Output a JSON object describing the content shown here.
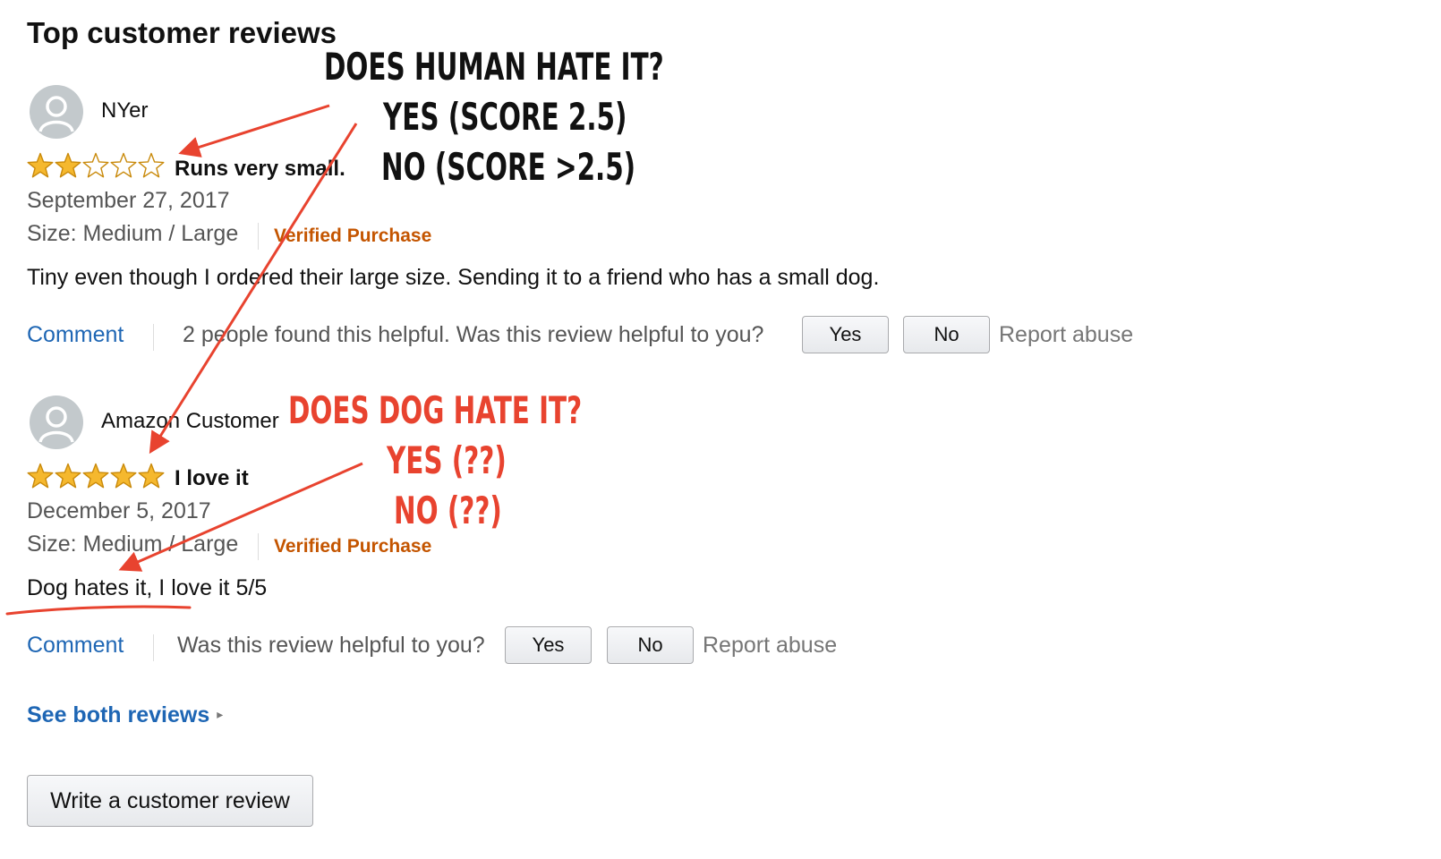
{
  "section_heading": "Top customer reviews",
  "reviews": [
    {
      "reviewer": "NYer",
      "rating": 2,
      "rating_max": 5,
      "title": "Runs very small.",
      "date": "September 27, 2017",
      "size": "Size: Medium / Large",
      "verified": "Verified Purchase",
      "body": "Tiny even though I ordered their large size. Sending it to a friend who has a small dog.",
      "comment_label": "Comment",
      "helpful_text": "2 people found this helpful. Was this review helpful to you?",
      "yes_label": "Yes",
      "no_label": "No",
      "report_label": "Report abuse"
    },
    {
      "reviewer": "Amazon Customer",
      "rating": 5,
      "rating_max": 5,
      "title": "I love it",
      "date": "December 5, 2017",
      "size": "Size: Medium / Large",
      "verified": "Verified Purchase",
      "body": "Dog hates it, I love it 5/5",
      "comment_label": "Comment",
      "helpful_text": "Was this review helpful to you?",
      "yes_label": "Yes",
      "no_label": "No",
      "report_label": "Report abuse"
    }
  ],
  "see_both_label": "See both reviews",
  "write_review_label": "Write a customer review",
  "annotations": {
    "human": [
      "DOES HUMAN HATE IT?",
      "YES (SCORE 2.5)",
      "NO (SCORE >2.5)"
    ],
    "dog": [
      "DOES DOG HATE IT?",
      "YES (??)",
      "NO (??)"
    ]
  },
  "colors": {
    "link": "#1e66b4",
    "verified": "#c45500",
    "star_fill": "#f5b82e",
    "star_stroke": "#c98a0b",
    "annotation_red": "#e8432f"
  },
  "icons": {
    "avatar": "user-avatar-icon",
    "star_full": "star-filled-icon",
    "star_empty": "star-empty-icon",
    "caret": "caret-right-icon"
  }
}
